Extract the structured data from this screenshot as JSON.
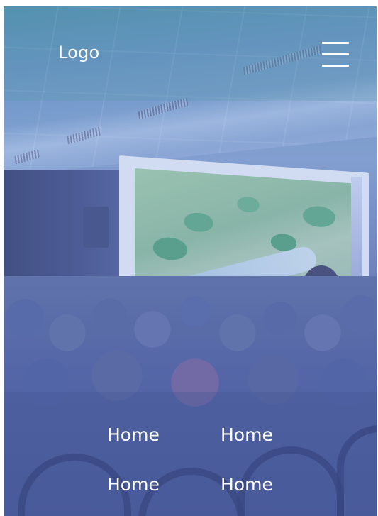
{
  "header": {
    "logo_text": "Logo",
    "menu_icon": "hamburger-menu-icon"
  },
  "hero": {
    "image_subject": "audience watching a game on a large projection screen"
  },
  "nav": {
    "items": [
      {
        "label": "Home"
      },
      {
        "label": "Home"
      },
      {
        "label": "Home"
      },
      {
        "label": "Home"
      }
    ]
  },
  "colors": {
    "text": "#ffffff",
    "overlay_tint": "#5a96aa",
    "nav_tint": "#4655a0"
  }
}
